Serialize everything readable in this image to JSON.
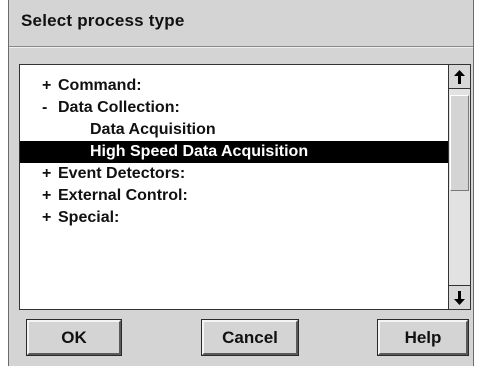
{
  "dialog": {
    "title": "Select process type"
  },
  "tree": {
    "items": [
      {
        "symbol": "+",
        "label": "Command:",
        "selected": false
      },
      {
        "symbol": "-",
        "label": "Data Collection:",
        "selected": false
      },
      {
        "symbol": "",
        "label": "Data Acquisition",
        "selected": false
      },
      {
        "symbol": "",
        "label": "High Speed Data Acquisition",
        "selected": true
      },
      {
        "symbol": "+",
        "label": "Event Detectors:",
        "selected": false
      },
      {
        "symbol": "+",
        "label": "External Control:",
        "selected": false
      },
      {
        "symbol": "+",
        "label": "Special:",
        "selected": false
      }
    ]
  },
  "scrollbar": {
    "up_icon": "arrow-up-icon",
    "down_icon": "arrow-down-icon"
  },
  "buttons": {
    "ok_label": "OK",
    "cancel_label": "Cancel",
    "help_label": "Help"
  }
}
